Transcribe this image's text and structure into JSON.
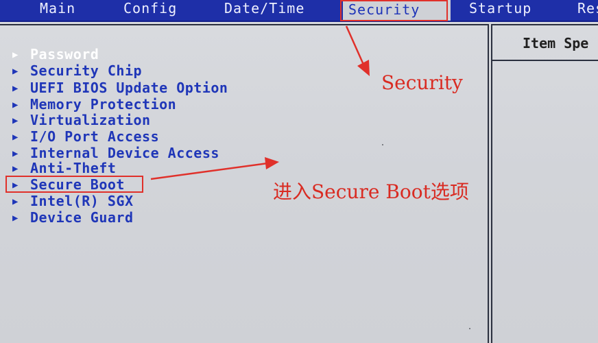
{
  "topbar": {
    "tabs": [
      {
        "label": "Main"
      },
      {
        "label": "Config"
      },
      {
        "label": "Date/Time"
      },
      {
        "label": "Security"
      },
      {
        "label": "Startup"
      },
      {
        "label": "Res"
      }
    ]
  },
  "help_panel": {
    "title": "Item Spe"
  },
  "menu": {
    "items": [
      {
        "label": "Password"
      },
      {
        "label": "Security Chip"
      },
      {
        "label": "UEFI BIOS Update Option"
      },
      {
        "label": "Memory Protection"
      },
      {
        "label": "Virtualization"
      },
      {
        "label": "I/O Port Access"
      },
      {
        "label": "Internal Device Access"
      },
      {
        "label": "Anti-Theft"
      },
      {
        "label": "Secure Boot"
      },
      {
        "label": "Intel(R) SGX"
      },
      {
        "label": "Device Guard"
      }
    ],
    "arrow_glyph": "▶"
  },
  "annotations": {
    "security_note": "Security",
    "secure_boot_note": "进入Secure Boot选项"
  },
  "colors": {
    "topbar_bg": "#1e2fa8",
    "menu_text": "#1f36b8",
    "annotation_red": "#d92b22"
  }
}
